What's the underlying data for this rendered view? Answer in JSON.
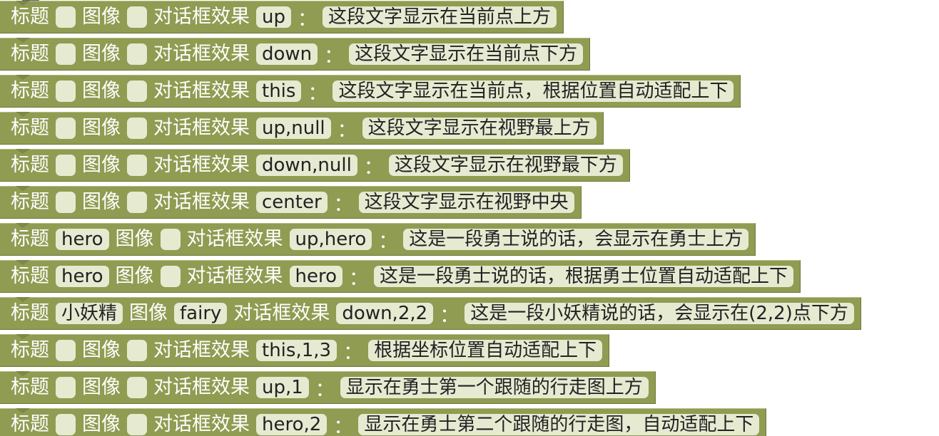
{
  "labels": {
    "title": "标题",
    "image": "图像",
    "effect": "对话框效果",
    "colon": "："
  },
  "blocks": [
    {
      "title": "",
      "image": "",
      "effect": "up",
      "text": "这段文字显示在当前点上方"
    },
    {
      "title": "",
      "image": "",
      "effect": "down",
      "text": "这段文字显示在当前点下方"
    },
    {
      "title": "",
      "image": "",
      "effect": "this",
      "text": "这段文字显示在当前点，根据位置自动适配上下"
    },
    {
      "title": "",
      "image": "",
      "effect": "up,null",
      "text": "这段文字显示在视野最上方"
    },
    {
      "title": "",
      "image": "",
      "effect": "down,null",
      "text": "这段文字显示在视野最下方"
    },
    {
      "title": "",
      "image": "",
      "effect": "center",
      "text": "这段文字显示在视野中央"
    },
    {
      "title": "hero",
      "image": "",
      "effect": "up,hero",
      "text": "这是一段勇士说的话，会显示在勇士上方"
    },
    {
      "title": "hero",
      "image": "",
      "effect": "hero",
      "text": "这是一段勇士说的话，根据勇士位置自动适配上下"
    },
    {
      "title": "小妖精",
      "image": "fairy",
      "effect": "down,2,2",
      "text": "这是一段小妖精说的话，会显示在(2,2)点下方"
    },
    {
      "title": "",
      "image": "",
      "effect": "this,1,3",
      "text": "根据坐标位置自动适配上下"
    },
    {
      "title": "",
      "image": "",
      "effect": "up,1",
      "text": "显示在勇士第一个跟随的行走图上方"
    },
    {
      "title": "",
      "image": "",
      "effect": "hero,2",
      "text": "显示在勇士第二个跟随的行走图，自动适配上下"
    }
  ]
}
